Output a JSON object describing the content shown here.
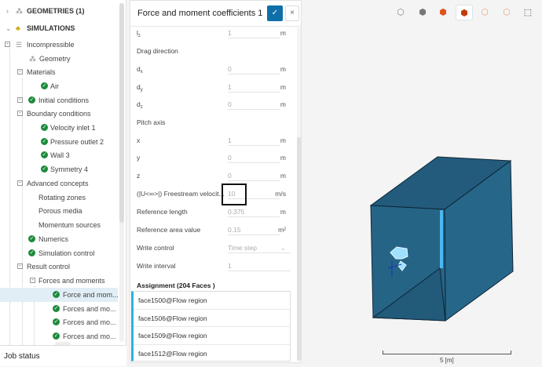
{
  "tree": {
    "geometries": "GEOMETRIES (1)",
    "simulations": "SIMULATIONS",
    "items": [
      {
        "label": "Incompressible"
      },
      {
        "label": "Geometry"
      },
      {
        "label": "Materials"
      },
      {
        "label": "Air"
      },
      {
        "label": "Initial conditions"
      },
      {
        "label": "Boundary conditions"
      },
      {
        "label": "Velocity inlet 1"
      },
      {
        "label": "Pressure outlet 2"
      },
      {
        "label": "Wall 3"
      },
      {
        "label": "Symmetry 4"
      },
      {
        "label": "Advanced concepts"
      },
      {
        "label": "Rotating zones"
      },
      {
        "label": "Porous media"
      },
      {
        "label": "Momentum sources"
      },
      {
        "label": "Numerics"
      },
      {
        "label": "Simulation control"
      },
      {
        "label": "Result control"
      },
      {
        "label": "Forces and moments"
      },
      {
        "label": "Force and mom..."
      },
      {
        "label": "Forces and mo..."
      },
      {
        "label": "Forces and mo..."
      },
      {
        "label": "Forces and mo..."
      }
    ]
  },
  "job_status": "Job status",
  "panel": {
    "title": "Force and moment coefficients 1",
    "ok_icon": "✓",
    "close_icon": "×",
    "lz": {
      "label": "l",
      "sub": "z",
      "value": "1",
      "unit": "m"
    },
    "drag_direction": "Drag direction",
    "dx": {
      "label": "d",
      "sub": "x",
      "value": "0",
      "unit": "m"
    },
    "dy": {
      "label": "d",
      "sub": "y",
      "value": "1",
      "unit": "m"
    },
    "dz": {
      "label": "d",
      "sub": "z",
      "value": "0",
      "unit": "m"
    },
    "pitch_axis": "Pitch axis",
    "x": {
      "label": "x",
      "value": "1",
      "unit": "m"
    },
    "y": {
      "label": "y",
      "value": "0",
      "unit": "m"
    },
    "z": {
      "label": "z",
      "value": "0",
      "unit": "m"
    },
    "freestream": {
      "label": "(|U<∞>|) Freestream velocit...",
      "value": "10",
      "unit": "m/s"
    },
    "ref_length": {
      "label": "Reference length",
      "value": "0.375",
      "unit": "m"
    },
    "ref_area": {
      "label": "Reference area value",
      "value": "0.15",
      "unit": "m²"
    },
    "write_control": {
      "label": "Write control",
      "value": "Time step"
    },
    "write_interval": {
      "label": "Write interval",
      "value": "1"
    },
    "assignment_title": "Assignment (204 Faces )",
    "assignments": [
      "face1500@Flow region",
      "face1506@Flow region",
      "face1509@Flow region",
      "face1512@Flow region"
    ]
  },
  "viewer": {
    "scale_label": "5 [m]",
    "box_color": "#256488"
  }
}
